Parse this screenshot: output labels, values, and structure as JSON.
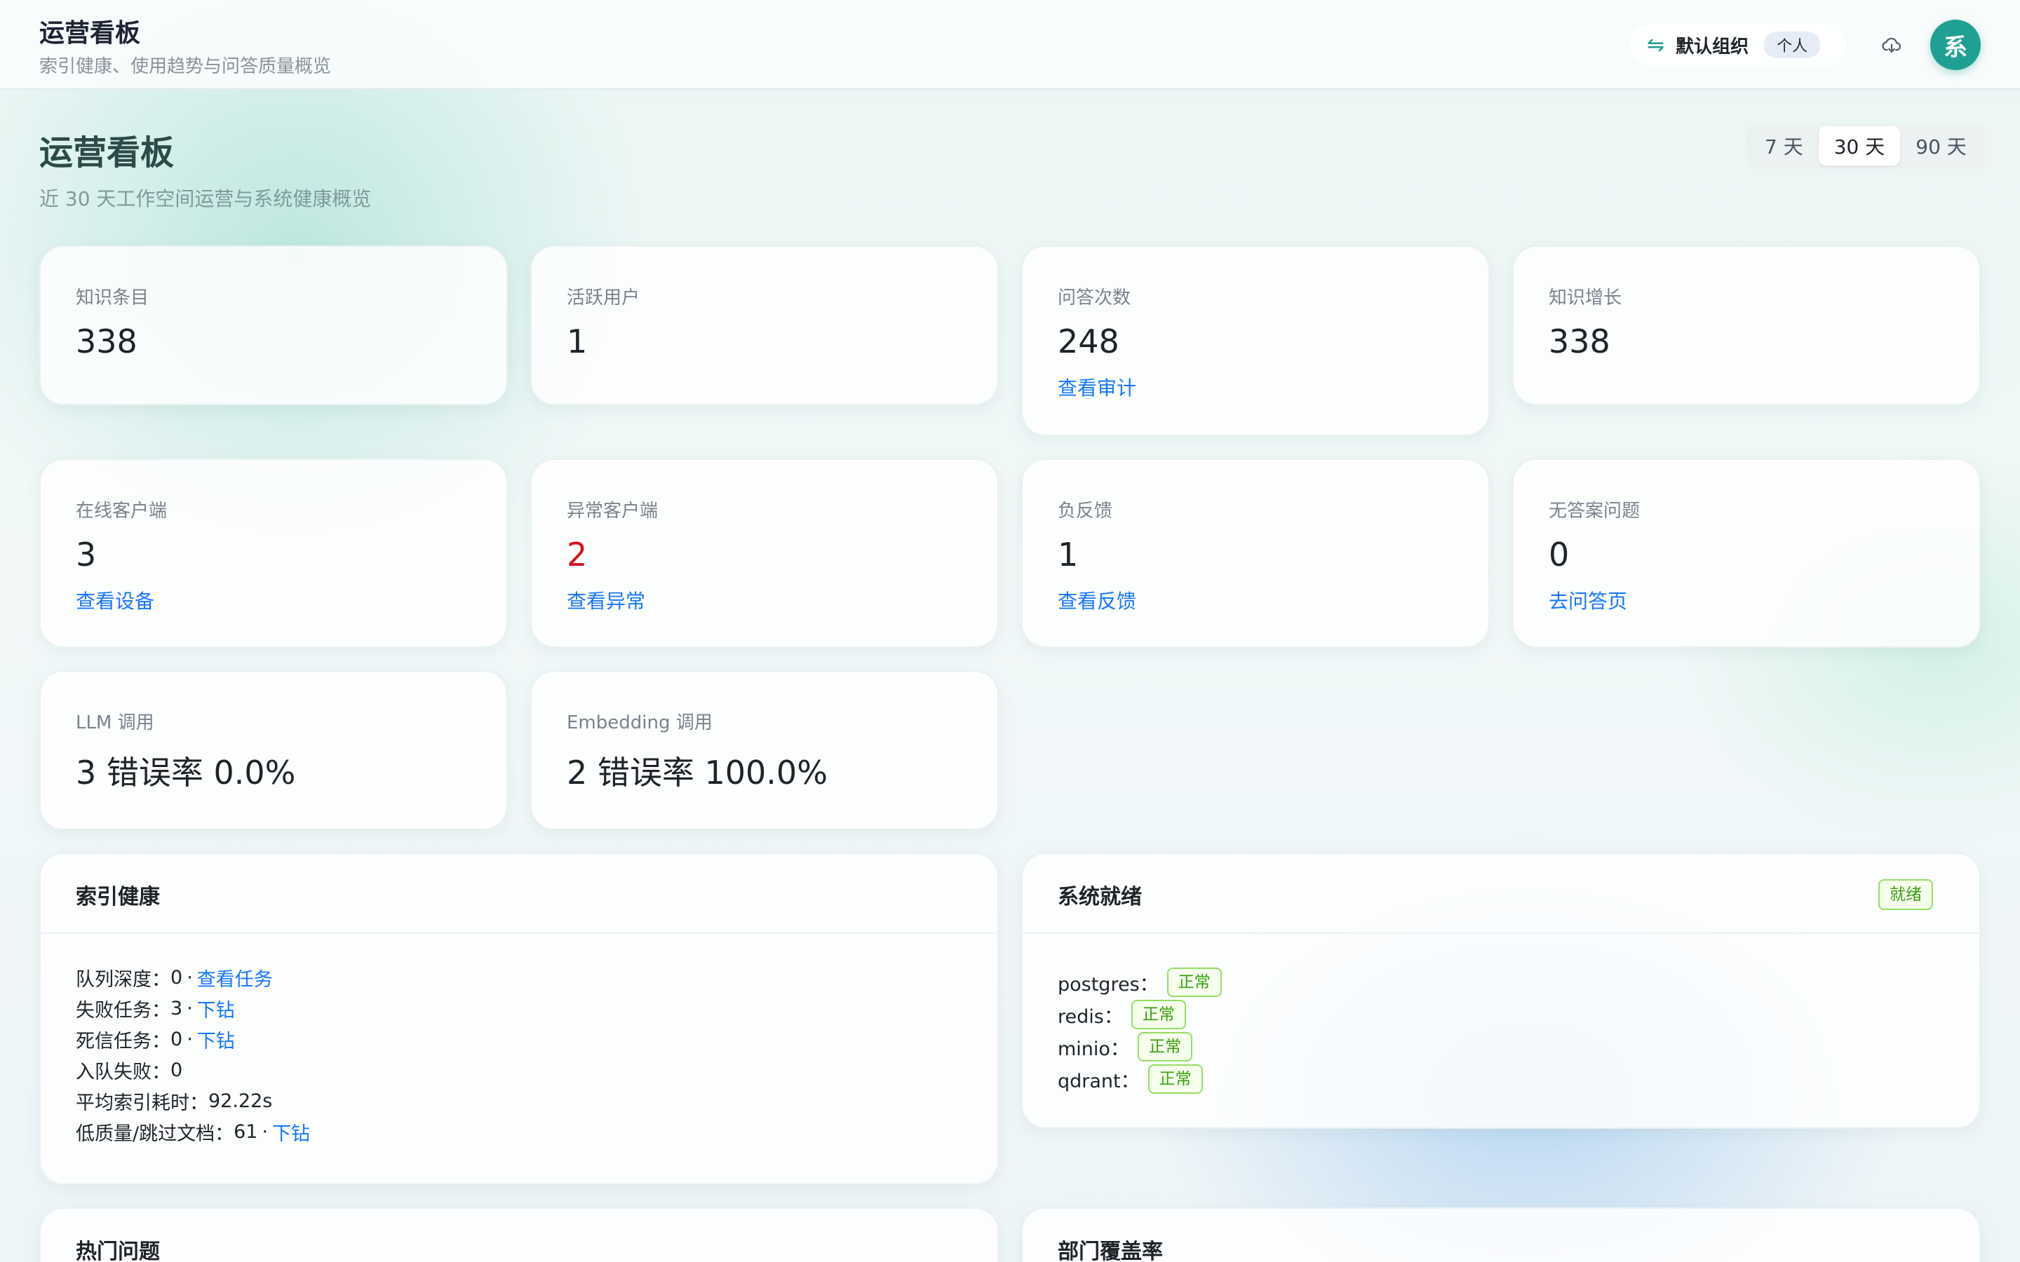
{
  "header": {
    "title": "运营看板",
    "subtitle": "索引健康、使用趋势与问答质量概览",
    "org_name": "默认组织",
    "org_tag": "个人",
    "avatar_text": "系"
  },
  "page": {
    "title": "运营看板",
    "subtitle": "近 30 天工作空间运营与系统健康概览",
    "ranges": [
      "7 天",
      "30 天",
      "90 天"
    ],
    "active_range": "30 天"
  },
  "stats": [
    {
      "label": "知识条目",
      "value": "338",
      "link": ""
    },
    {
      "label": "活跃用户",
      "value": "1",
      "link": ""
    },
    {
      "label": "问答次数",
      "value": "248",
      "link": "查看审计"
    },
    {
      "label": "知识增长",
      "value": "338",
      "link": ""
    },
    {
      "label": "在线客户端",
      "value": "3",
      "link": "查看设备"
    },
    {
      "label": "异常客户端",
      "value": "2",
      "link": "查看异常"
    },
    {
      "label": "负反馈",
      "value": "1",
      "link": "查看反馈"
    },
    {
      "label": "无答案问题",
      "value": "0",
      "link": "去问答页"
    },
    {
      "label": "LLM 调用",
      "value": "3 错误率 0.0%",
      "link": ""
    },
    {
      "label": "Embedding 调用",
      "value": "2 错误率 100.0%",
      "link": ""
    }
  ],
  "index_health": {
    "title": "索引健康",
    "rows": [
      {
        "label": "队列深度：",
        "value": "0",
        "link": "查看任务"
      },
      {
        "label": "失败任务：",
        "value": "3",
        "link": "下钻"
      },
      {
        "label": "死信任务：",
        "value": "0",
        "link": "下钻"
      },
      {
        "label": "入队失败：",
        "value": "0",
        "link": ""
      },
      {
        "label": "平均索引耗时：",
        "value": "92.22s",
        "link": ""
      },
      {
        "label": "低质量/跳过文档：",
        "value": "61",
        "link": "下钻"
      }
    ]
  },
  "system_ready": {
    "title": "系统就绪",
    "status": "就绪",
    "services": [
      {
        "name": "postgres：",
        "status": "正常"
      },
      {
        "name": "redis：",
        "status": "正常"
      },
      {
        "name": "minio：",
        "status": "正常"
      },
      {
        "name": "qdrant：",
        "status": "正常"
      }
    ]
  },
  "bottom_panels": {
    "hot_questions_title": "热门问题",
    "dept_coverage_title": "部门覆盖率"
  },
  "colors": {
    "brand": "#1fa093",
    "link": "#1677ff",
    "danger": "#d4141c",
    "success": "#389e0d"
  },
  "icons": {
    "org_switch": "swap-arrows-icon",
    "download": "cloud-download-icon"
  }
}
